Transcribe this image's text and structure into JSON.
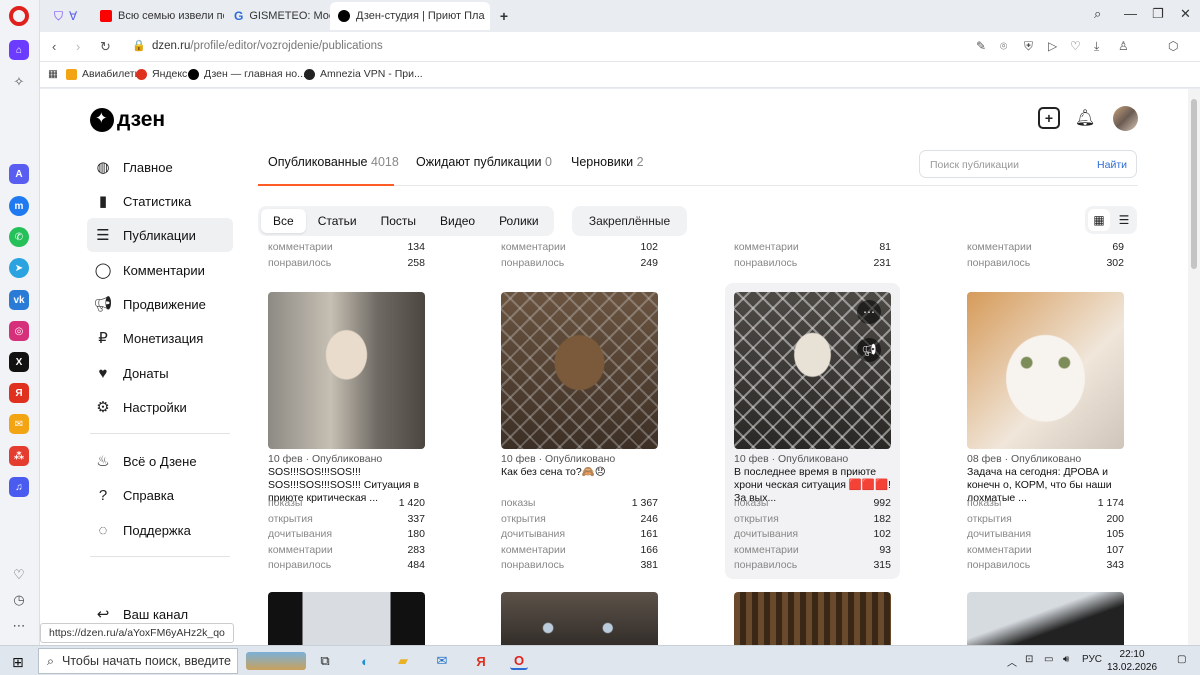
{
  "browser": {
    "tabs": [
      {
        "label": "Всю семью извели порч"
      },
      {
        "label": "GISMETEO: Москвичка сл"
      },
      {
        "label": "Дзен-студия | Приют Пла"
      }
    ],
    "new_tab": "+",
    "url_host": "dzen.ru",
    "url_path": "/profile/editor/vozrojdenie/publications",
    "bookmarks": [
      "Авиабилеты",
      "Яндекс",
      "Дзен — главная но...",
      "Amnezia VPN - При..."
    ],
    "status_url": "https://dzen.ru/a/aYoxFM6yAHz2k_qo"
  },
  "brand": {
    "logo_text": "дзен",
    "accent": "#ff5b27",
    "link": "#2c6bd6"
  },
  "menu": {
    "items": [
      {
        "label": "Главное",
        "icon": "globe-icon"
      },
      {
        "label": "Статистика",
        "icon": "bars-icon"
      },
      {
        "label": "Публикации",
        "icon": "stack-icon",
        "selected": true
      },
      {
        "label": "Комментарии",
        "icon": "comment-icon"
      },
      {
        "label": "Продвижение",
        "icon": "megaphone-icon"
      },
      {
        "label": "Монетизация",
        "icon": "ruble-icon"
      },
      {
        "label": "Донаты",
        "icon": "donate-icon"
      },
      {
        "label": "Настройки",
        "icon": "gear-icon"
      }
    ],
    "items2": [
      {
        "label": "Всё о Дзене",
        "icon": "flame-icon"
      },
      {
        "label": "Справка",
        "icon": "help-icon"
      },
      {
        "label": "Поддержка",
        "icon": "support-icon"
      }
    ],
    "channel": {
      "label": "Ваш канал"
    }
  },
  "content_tabs": [
    {
      "label": "Опубликованные",
      "count": "4018"
    },
    {
      "label": "Ожидают публикации",
      "count": "0"
    },
    {
      "label": "Черновики",
      "count": "2"
    }
  ],
  "search": {
    "placeholder": "Поиск публикации",
    "button": "Найти"
  },
  "filters": [
    "Все",
    "Статьи",
    "Посты",
    "Видео",
    "Ролики"
  ],
  "pinned_filter": "Закреплённые",
  "stat_labels": {
    "views": "показы",
    "opens": "открытия",
    "reads": "дочитывания",
    "comments": "комментарии",
    "likes": "понравилось"
  },
  "top_partial": [
    {
      "comments": "134",
      "likes": "258"
    },
    {
      "comments": "102",
      "likes": "249"
    },
    {
      "comments": "81",
      "likes": "231"
    },
    {
      "comments": "69",
      "likes": "302"
    }
  ],
  "cards": [
    {
      "meta": "10 фев · Опубликовано",
      "title": "SOS!!!SOS!!!SOS!!! SOS!!!SOS!!!SOS!!! Ситуация в приюте критическая ...",
      "views": "1 420",
      "opens": "337",
      "reads": "180",
      "comments": "283",
      "likes": "484"
    },
    {
      "meta": "10 фев · Опубликовано",
      "title": "Как без сена то?🙈😞",
      "views": "1 367",
      "opens": "246",
      "reads": "161",
      "comments": "166",
      "likes": "381"
    },
    {
      "meta": "10 фев · Опубликовано",
      "title": "В последнее время в приюте хрони ческая ситуация 🟥🟥🟥! За вых...",
      "views": "992",
      "opens": "182",
      "reads": "102",
      "comments": "93",
      "likes": "315"
    },
    {
      "meta": "08 фев · Опубликовано",
      "title": "Задача на сегодня: ДРОВА и конечн о, КОРМ, что бы наши лохматые ...",
      "views": "1 174",
      "opens": "200",
      "reads": "105",
      "comments": "107",
      "likes": "343"
    }
  ],
  "taskbar": {
    "search_placeholder": "Чтобы начать поиск, введите",
    "lang": "РУС",
    "time": "22:10",
    "date": "13.02.2026"
  }
}
